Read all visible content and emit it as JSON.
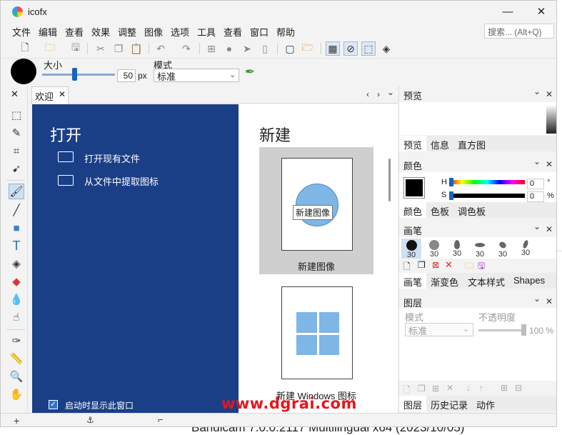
{
  "background_text": "Bandicam 7.0.0.2117 Multilingual x64 (2023/10/05)",
  "window": {
    "title": "icofx",
    "controls": {
      "minimize": "—",
      "maximize": "☐",
      "close": "✕"
    }
  },
  "menu": [
    "文件",
    "编辑",
    "查看",
    "效果",
    "调整",
    "图像",
    "选项",
    "工具",
    "查看",
    "窗口",
    "帮助"
  ],
  "search": {
    "placeholder": "搜索... (Alt+Q)"
  },
  "props": {
    "size_label": "大小",
    "size_value": "50",
    "size_unit": "px",
    "size_slider": 0.45,
    "mode_label": "模式",
    "mode_value": "标准"
  },
  "tabs": {
    "welcome": "欢迎",
    "close": "✕",
    "nav": [
      "‹",
      "›",
      "⌄"
    ]
  },
  "welcome": {
    "open_title": "打开",
    "open_existing": "打开现有文件",
    "extract_icon": "从文件中提取图标",
    "show_on_start": "启动时显示此窗口",
    "show_on_start_checked": true,
    "new_title": "新建",
    "new_image": "新建图像",
    "new_image_tooltip": "新建图像",
    "new_windows_icon": "新建 Windows 图标"
  },
  "panels": {
    "preview": {
      "title": "预览",
      "tabs": [
        "预览",
        "信息",
        "直方图"
      ],
      "active": 0
    },
    "color": {
      "title": "颜色",
      "h_label": "H",
      "h_value": "0",
      "h_unit": "°",
      "s_label": "S",
      "s_value": "0",
      "s_unit": "%",
      "current": "#000000",
      "tabs": [
        "颜色",
        "色板",
        "调色板"
      ],
      "active": 0
    },
    "brush": {
      "title": "画笔",
      "sizes": [
        "30",
        "30",
        "30",
        "30",
        "30",
        "30"
      ],
      "tabs": [
        "画笔",
        "渐变色",
        "文本样式",
        "Shapes"
      ],
      "active": 0
    },
    "layers": {
      "title": "图层",
      "mode_label": "模式",
      "mode_value": "标准",
      "opacity_label": "不透明度",
      "opacity_value": "100",
      "opacity_unit": "%",
      "tabs": [
        "图层",
        "历史记录",
        "动作"
      ],
      "active": 0
    },
    "chevron": "⌄",
    "close": "✕"
  },
  "status": {
    "plus": "+",
    "anchor": "⚓",
    "crop": "⌐"
  },
  "watermark": "www.dgrai.com",
  "colors": {
    "welcome_bg": "#1b3f86",
    "accent": "#1565c0",
    "watermark": "#e8151b"
  }
}
